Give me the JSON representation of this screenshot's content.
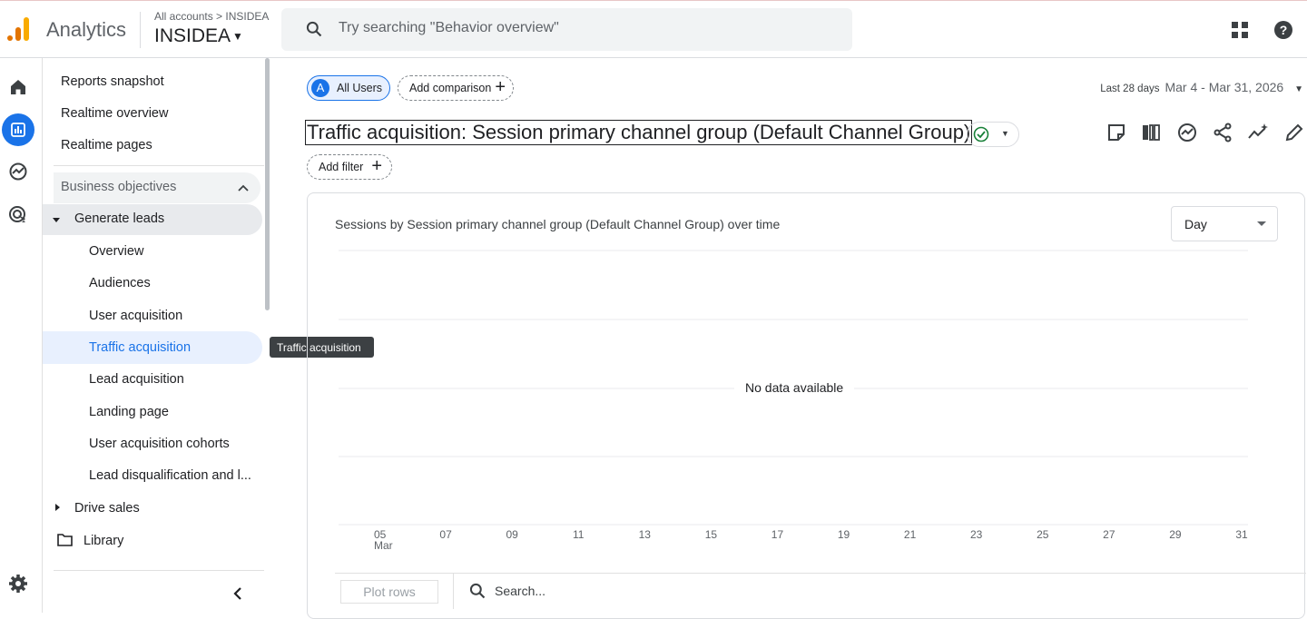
{
  "header": {
    "app_name": "Analytics",
    "breadcrumb": "All accounts > INSIDEA",
    "property": "INSIDEA",
    "search_placeholder": "Try searching \"Behavior overview\""
  },
  "colors": {
    "accent": "#1a73e8",
    "logo_orange": "#f9ab00",
    "logo_dark": "#e37400"
  },
  "nav": {
    "top_items": [
      "Reports snapshot",
      "Realtime overview",
      "Realtime pages"
    ],
    "section": "Business objectives",
    "group": "Generate leads",
    "sub_items": [
      "Overview",
      "Audiences",
      "User acquisition",
      "Traffic acquisition",
      "Lead acquisition",
      "Landing page",
      "User acquisition cohorts",
      "Lead disqualification and l..."
    ],
    "selected": "Traffic acquisition",
    "collapsed_group": "Drive sales",
    "library": "Library",
    "tooltip": "Traffic acquisition"
  },
  "toolbar": {
    "segment_badge": "A",
    "segment": "All Users",
    "add_comparison": "Add comparison",
    "date_label": "Last 28 days",
    "date_range": "Mar 4 - Mar 31, 2026",
    "title": "Traffic acquisition: Session primary channel group (Default Channel Group)",
    "add_filter": "Add filter"
  },
  "card": {
    "title": "Sessions by Session primary channel group (Default Channel Group) over time",
    "granularity": "Day",
    "no_data": "No data available",
    "plot_rows": "Plot rows",
    "search_placeholder": "Search..."
  },
  "chart_data": {
    "type": "line",
    "title": "Sessions by Session primary channel group (Default Channel Group) over time",
    "x_ticks": [
      "05",
      "07",
      "09",
      "11",
      "13",
      "15",
      "17",
      "19",
      "21",
      "23",
      "25",
      "27",
      "29",
      "31"
    ],
    "x_tick_sublabel": "Mar",
    "series": [],
    "grid": true,
    "message": "No data available"
  }
}
